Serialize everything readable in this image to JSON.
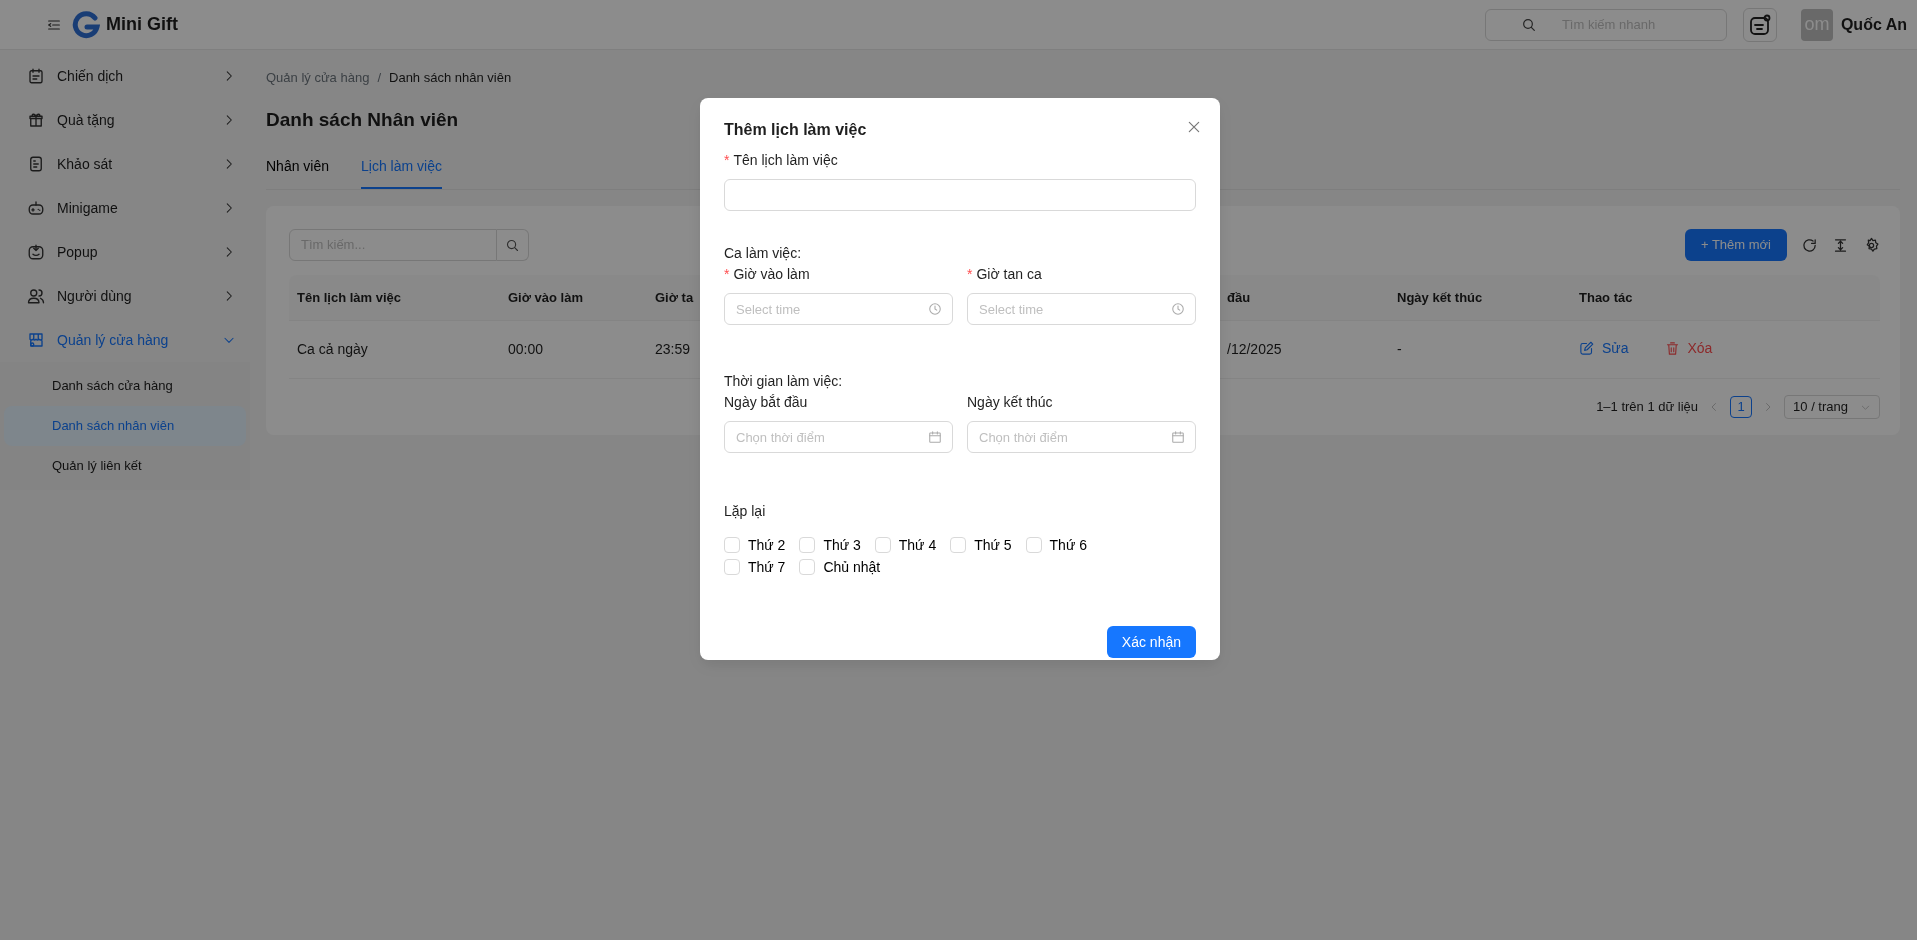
{
  "header": {
    "app_name": "Mini Gift",
    "search_placeholder": "Tìm kiếm nhanh",
    "user": {
      "avatar_text": "om",
      "name": "Quốc An"
    }
  },
  "sidebar": {
    "items": [
      {
        "label": "Chiến dịch",
        "expanded": false,
        "selected": false
      },
      {
        "label": "Quà tặng",
        "expanded": false,
        "selected": false
      },
      {
        "label": "Khảo sát",
        "expanded": false,
        "selected": false
      },
      {
        "label": "Minigame",
        "expanded": false,
        "selected": false
      },
      {
        "label": "Popup",
        "expanded": false,
        "selected": false
      },
      {
        "label": "Người dùng",
        "expanded": false,
        "selected": false
      },
      {
        "label": "Quản lý cửa hàng",
        "expanded": true,
        "selected": true,
        "children": [
          {
            "label": "Danh sách cửa hàng",
            "selected": false
          },
          {
            "label": "Danh sách nhân viên",
            "selected": true
          },
          {
            "label": "Quản lý liên kết",
            "selected": false
          }
        ]
      }
    ]
  },
  "breadcrumb": [
    "Quản lý cửa hàng",
    "Danh sách nhân viên"
  ],
  "breadcrumb_separator": "/",
  "page_title": "Danh sách Nhân viên",
  "tabs": [
    {
      "label": "Nhân viên",
      "selected": false
    },
    {
      "label": "Lịch làm việc",
      "selected": true
    }
  ],
  "toolbar": {
    "search_placeholder": "Tìm kiếm...",
    "add_button": "+ Thêm mới"
  },
  "table": {
    "columns": [
      "Tên lịch làm việc",
      "Giờ vào làm",
      "Giờ ta",
      "đầu",
      "Ngày kết thúc",
      "Thao tác"
    ],
    "rows": [
      {
        "cells": [
          "Ca cả ngày",
          "00:00",
          "23:59",
          "/12/2025",
          "-"
        ],
        "actions": [
          {
            "kind": "edit",
            "label": "Sửa"
          },
          {
            "kind": "delete",
            "label": "Xóa"
          }
        ]
      }
    ]
  },
  "pagination": {
    "summary": "1–1 trên 1 dữ liệu",
    "pages": [
      {
        "label": "1",
        "selected": true
      }
    ],
    "page_size": "10 / trang"
  },
  "modal": {
    "title": "Thêm lịch làm việc",
    "required_mark": "*",
    "name_field": {
      "label": "Tên lịch làm việc",
      "required": true
    },
    "shift_label": "Ca làm việc:",
    "shift_fields": [
      {
        "kind": "time",
        "label": "Giờ vào làm",
        "required": true,
        "placeholder": "Select time"
      },
      {
        "kind": "time",
        "label": "Giờ tan ca",
        "required": true,
        "placeholder": "Select time"
      }
    ],
    "period_label": "Thời gian làm việc:",
    "period_fields": [
      {
        "kind": "date",
        "label": "Ngày bắt đầu",
        "required": false,
        "placeholder": "Chọn thời điểm"
      },
      {
        "kind": "date",
        "label": "Ngày kết thúc",
        "required": false,
        "placeholder": "Chọn thời điểm"
      }
    ],
    "repeat_label": "Lặp lại",
    "days": [
      {
        "label": "Thứ 2",
        "checked": false
      },
      {
        "label": "Thứ 3",
        "checked": false
      },
      {
        "label": "Thứ 4",
        "checked": false
      },
      {
        "label": "Thứ 5",
        "checked": false
      },
      {
        "label": "Thứ 6",
        "checked": false
      },
      {
        "label": "Thứ 7",
        "checked": false
      },
      {
        "label": "Chủ nhật",
        "checked": false
      }
    ],
    "submit": "Xác nhận"
  }
}
